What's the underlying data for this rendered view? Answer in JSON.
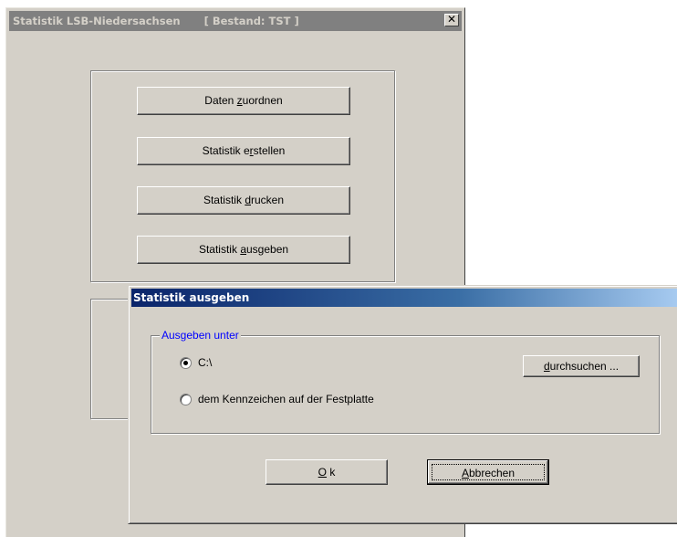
{
  "main_window": {
    "title": "Statistik LSB-Niedersachsen",
    "title_sub": "[ Bestand: TST ]",
    "close_glyph": "✕",
    "buttons": [
      {
        "pre": "Daten ",
        "key": "z",
        "post": "uordnen"
      },
      {
        "pre": "Statistik e",
        "key": "r",
        "post": "stellen"
      },
      {
        "pre": "Statistik ",
        "key": "d",
        "post": "rucken"
      },
      {
        "pre": "Statistik ",
        "key": "a",
        "post": "usgeben"
      }
    ]
  },
  "dialog": {
    "title": "Statistik ausgeben",
    "groupbox_label": "Ausgeben unter",
    "radio_path": {
      "label": "C:\\",
      "checked": true
    },
    "radio_plate": {
      "label": "dem Kennzeichen auf der Festplatte",
      "checked": false
    },
    "browse": {
      "key": "d",
      "post": "urchsuchen ..."
    },
    "ok": {
      "key": "O",
      "post": " k"
    },
    "cancel": {
      "key": "A",
      "post": "bbrechen"
    }
  }
}
